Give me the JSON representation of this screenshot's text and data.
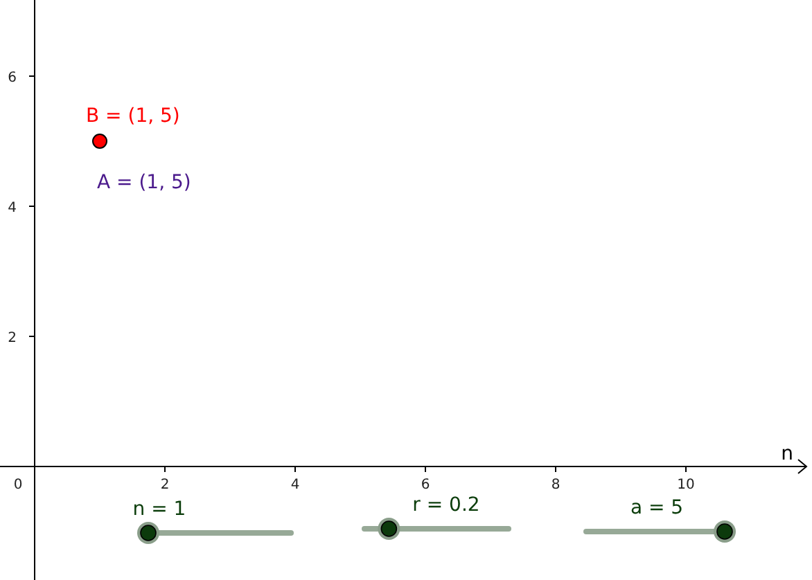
{
  "axes": {
    "x_label": "n",
    "origin_label": "0",
    "x_ticks": [
      "2",
      "4",
      "6",
      "8",
      "10"
    ],
    "y_ticks": [
      "6",
      "4",
      "2"
    ]
  },
  "point": {
    "color": "#ff0000"
  },
  "point_labels": [
    {
      "text": "B = (1, 5)",
      "color": "#ff0000"
    },
    {
      "text": "A = (1, 5)",
      "color": "#4b1a8c"
    }
  ],
  "sliders": [
    {
      "label": "n = 1",
      "level": 0
    },
    {
      "label": "r = 0.2",
      "level": 0.17
    },
    {
      "label": "a = 5",
      "level": 1
    }
  ]
}
